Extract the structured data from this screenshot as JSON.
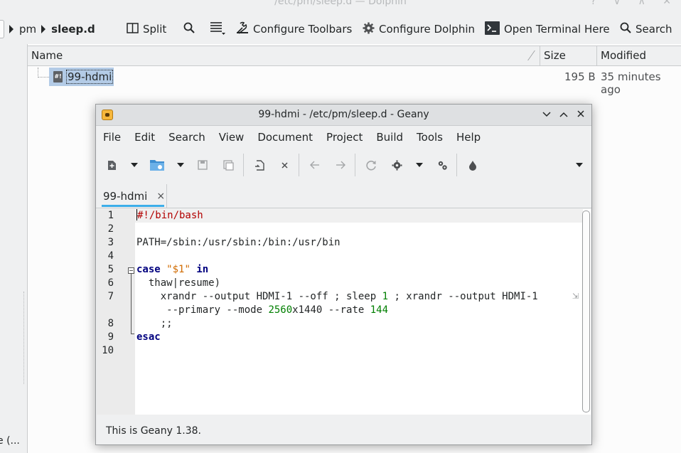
{
  "dolphin": {
    "window_title": "/etc/pm/sleep.d — Dolphin",
    "title_buttons": "? ∨ ∧ ✕",
    "breadcrumb": [
      "pm",
      "sleep.d"
    ],
    "toolbar": {
      "split": "Split",
      "configure_toolbars": "Configure Toolbars",
      "configure_dolphin": "Configure Dolphin",
      "open_terminal": "Open Terminal Here",
      "search": "Search"
    },
    "columns": {
      "name": "Name",
      "size": "Size",
      "modified": "Modified"
    },
    "files": [
      {
        "name": "99-hdmi",
        "size": "195 B",
        "modified": "35 minutes ago"
      }
    ],
    "places_truncated": "e (..."
  },
  "geany": {
    "window_title": "99-hdmi - /etc/pm/sleep.d - Geany",
    "menu": [
      "File",
      "Edit",
      "Search",
      "View",
      "Document",
      "Project",
      "Build",
      "Tools",
      "Help"
    ],
    "tab_label": "99-hdmi",
    "tab_close": "×",
    "line_numbers": [
      "1",
      "2",
      "3",
      "4",
      "5",
      "6",
      "7",
      "8",
      "9",
      "10"
    ],
    "code": {
      "l1": "#!/bin/bash",
      "l3": "PATH=/sbin:/usr/sbin:/bin:/usr/bin",
      "l5_kw1": "case",
      "l5_str": "\"$1\"",
      "l5_kw2": "in",
      "l6": "  thaw|resume)",
      "l7_a": "    xrandr --output HDMI-1 --off ; sleep ",
      "l7_num": "1",
      "l7_b": " ; xrandr --output HDMI-1",
      "l7w_a": "     --primary --mode ",
      "l7w_num1": "2560",
      "l7w_b": "x1440 --rate ",
      "l7w_num2": "144",
      "l8": "    ;;",
      "l9": "esac"
    },
    "status": "This is Geany 1.38."
  }
}
